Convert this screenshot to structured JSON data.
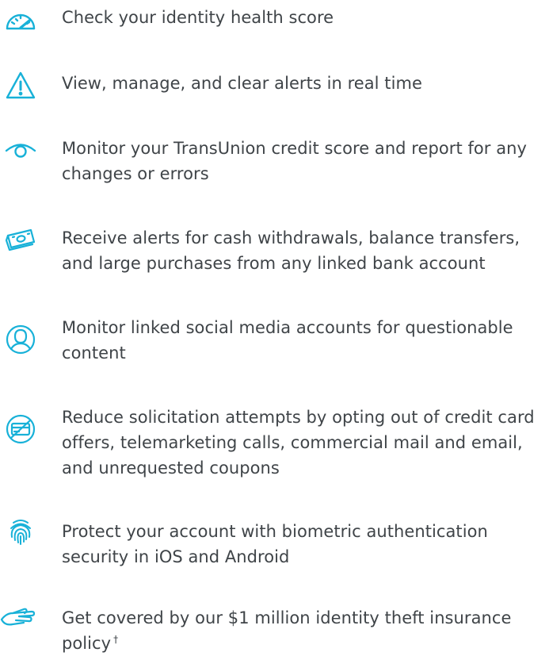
{
  "colors": {
    "accent": "#18b1d8",
    "text": "#3f4448",
    "background": "#ffffff"
  },
  "features": [
    {
      "icon": "speedometer-icon",
      "text": "Check your identity health score"
    },
    {
      "icon": "warning-icon",
      "text": "View, manage, and clear alerts in real time"
    },
    {
      "icon": "eye-icon",
      "text": "Monitor your TransUnion credit score and report for any changes or errors"
    },
    {
      "icon": "cash-icon",
      "text": "Receive alerts for cash withdrawals, balance transfers, and large purchases from any linked bank account"
    },
    {
      "icon": "user-profile-icon",
      "text": "Monitor linked social media accounts for questionable content"
    },
    {
      "icon": "blocked-credit-card-icon",
      "text": "Reduce solicitation attempts by opting out of credit card offers, telemarketing calls, commercial mail and email, and unrequested coupons"
    },
    {
      "icon": "fingerprint-icon",
      "text": "Protect your account with biometric authentication security in iOS and Android"
    },
    {
      "icon": "hand-icon",
      "text": "Get covered by our $1 million identity theft insurance policy",
      "footnote_mark": "†"
    }
  ]
}
